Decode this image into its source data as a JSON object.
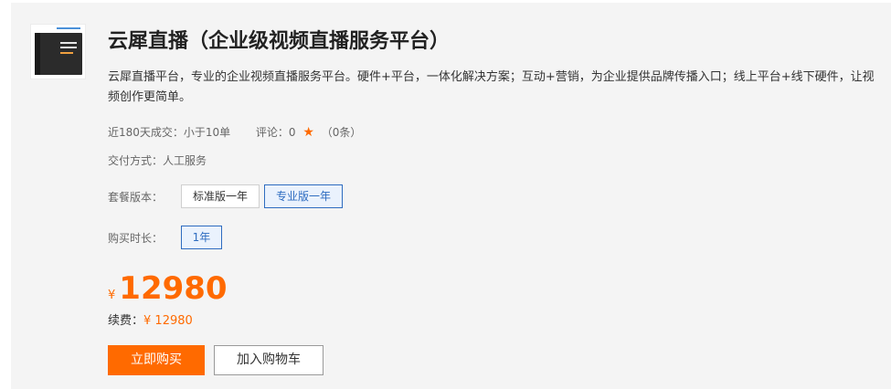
{
  "product": {
    "title": "云犀直播（企业级视频直播服务平台）",
    "description": "云犀直播平台，专业的企业视频直播服务平台。硬件+平台，一体化解决方案；互动+营销，为企业提供品牌传播入口；线上平台+线下硬件，让视频创作更简单。"
  },
  "meta": {
    "sales_label": "近180天成交：",
    "sales_value": "小于10单",
    "reviews_label": "评论：",
    "reviews_score": "0",
    "reviews_count": "（0条）",
    "delivery_label": "交付方式：",
    "delivery_value": "人工服务"
  },
  "package": {
    "label": "套餐版本：",
    "options": [
      "标准版一年",
      "专业版一年"
    ],
    "selected": "专业版一年"
  },
  "duration": {
    "label": "购买时长：",
    "options": [
      "1年"
    ],
    "selected": "1年"
  },
  "pricing": {
    "currency": "¥",
    "price": "12980",
    "renew_label": "续费：",
    "renew_value": "¥ 12980"
  },
  "actions": {
    "buy_label": "立即购买",
    "cart_label": "加入购物车"
  },
  "colors": {
    "accent": "#ff6a00",
    "selected_blue": "#2e6cc0",
    "panel_bg": "#f4f4f4"
  }
}
